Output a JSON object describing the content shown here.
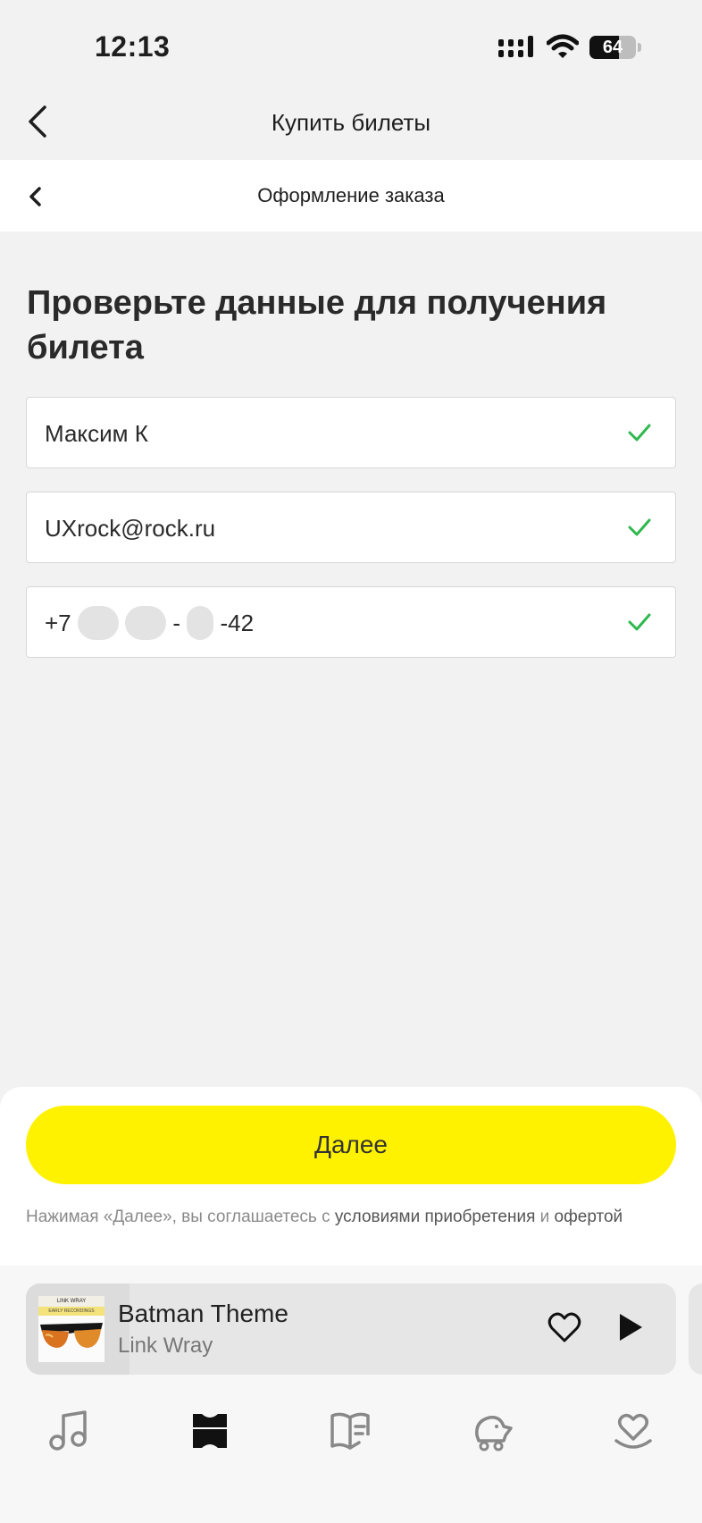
{
  "status_bar": {
    "time": "12:13",
    "battery": "64",
    "battery_level": 0.64
  },
  "top_nav": {
    "title": "Купить билеты"
  },
  "sub_header": {
    "title": "Оформление заказа"
  },
  "form": {
    "heading": "Проверьте данные для получения билета",
    "name_value": "Максим К",
    "email_value": "UXrock@rock.ru",
    "phone_prefix": "+7",
    "phone_suffix": "-42",
    "check_color": "#2fb84e"
  },
  "bottom": {
    "next_label": "Далее",
    "legal_text": "Нажимая «Далее», вы соглашаетесь с ",
    "legal_link1": "условиями приобретения",
    "legal_and": " и ",
    "legal_link2": "офертой"
  },
  "player": {
    "title": "Batman Theme",
    "artist": "Link Wray",
    "album_text": "LINK WRAY",
    "album_sub": "EARLY RECORDINGS",
    "progress": 0.16
  },
  "tabs": [
    "music-icon",
    "tickets-icon",
    "books-icon",
    "kids-icon",
    "favorites-icon"
  ],
  "colors": {
    "accent_yellow": "#fff200",
    "success_green": "#2fb84e"
  }
}
